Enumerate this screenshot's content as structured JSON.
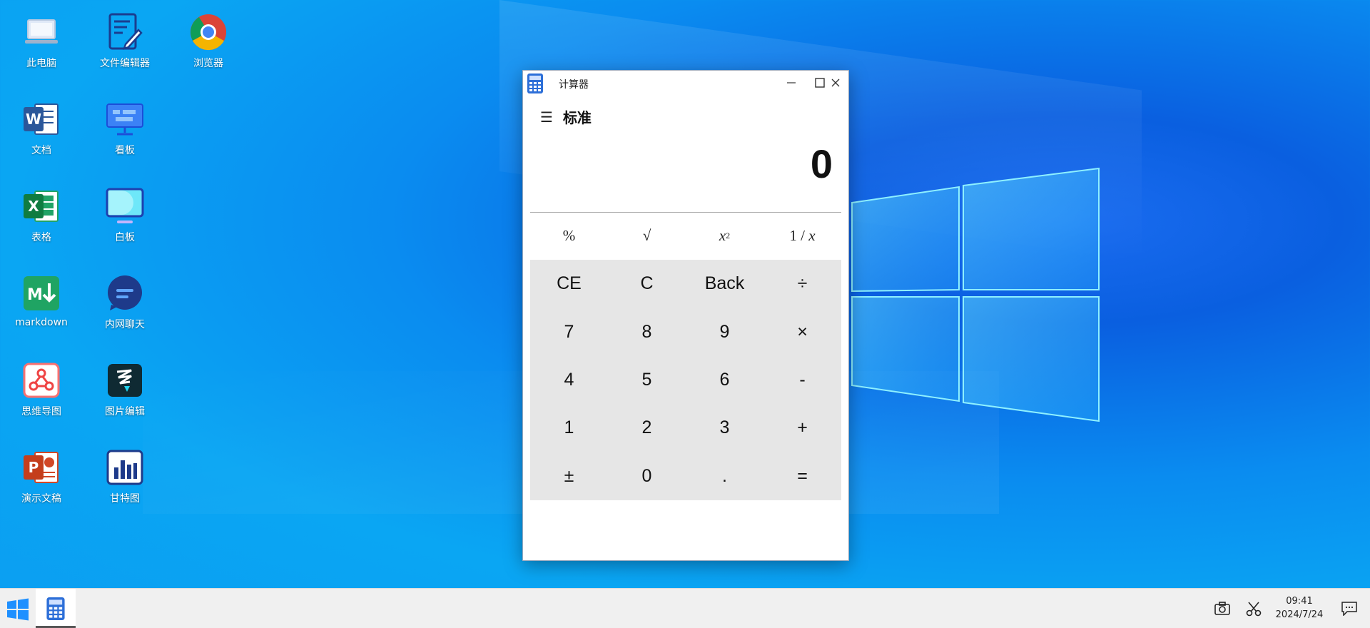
{
  "desktop": {
    "icons": [
      {
        "label": "此电脑",
        "icon": "computer-icon"
      },
      {
        "label": "文件编辑器",
        "icon": "file-editor-icon"
      },
      {
        "label": "浏览器",
        "icon": "chrome-icon"
      },
      {
        "label": "文档",
        "icon": "word-icon"
      },
      {
        "label": "看板",
        "icon": "kanban-icon"
      },
      {
        "label": "表格",
        "icon": "excel-icon"
      },
      {
        "label": "白板",
        "icon": "whiteboard-icon"
      },
      {
        "label": "markdown",
        "icon": "markdown-icon"
      },
      {
        "label": "内网聊天",
        "icon": "chat-icon"
      },
      {
        "label": "思维导图",
        "icon": "mindmap-icon"
      },
      {
        "label": "图片编辑",
        "icon": "image-editor-icon"
      },
      {
        "label": "演示文稿",
        "icon": "powerpoint-icon"
      },
      {
        "label": "甘特图",
        "icon": "gantt-icon"
      }
    ]
  },
  "calculator": {
    "title": "计算器",
    "mode": "标准",
    "menu_icon": "☰",
    "display": "0",
    "window_controls": {
      "minimize": "—",
      "maximize": "☐",
      "close": "✕"
    },
    "sci_row": {
      "percent": "%",
      "sqrt": "√",
      "square_base": "x",
      "square_exp": "2",
      "reciprocal_num": "1 / ",
      "reciprocal_var": "x"
    },
    "keys": [
      "CE",
      "C",
      "Back",
      "÷",
      "7",
      "8",
      "9",
      "×",
      "4",
      "5",
      "6",
      "-",
      "1",
      "2",
      "3",
      "+",
      "±",
      "0",
      ".",
      "="
    ]
  },
  "taskbar": {
    "time": "09:41",
    "date": "2024/7/24"
  },
  "colors": {
    "desktop_bg": "#0a8cf0",
    "keypad_bg": "#e6e6e6",
    "taskbar_bg": "#f0f0f0"
  }
}
